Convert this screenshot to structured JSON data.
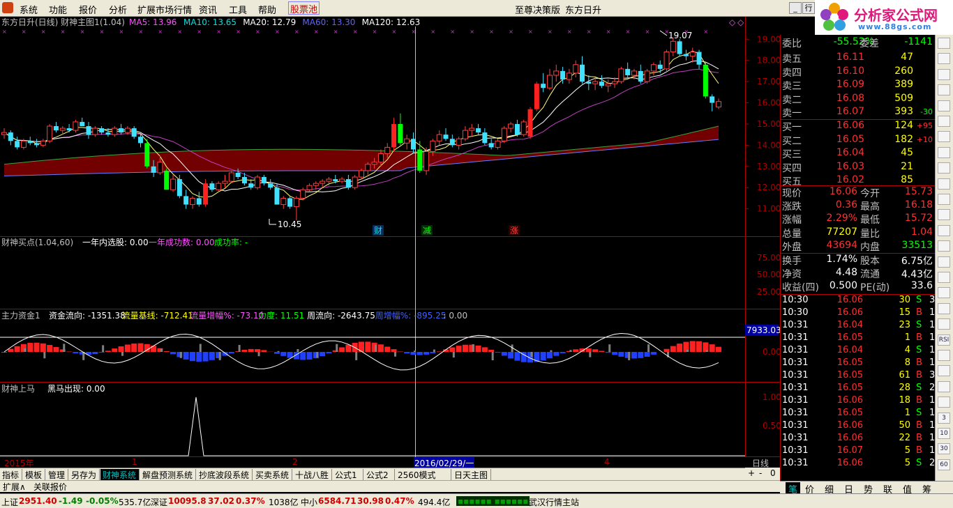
{
  "menu": {
    "items": [
      "系统",
      "功能",
      "报价",
      "分析",
      "扩展市场行情",
      "资讯",
      "工具",
      "帮助",
      "股票池"
    ],
    "center": "至尊决策版",
    "stock": "东方日升",
    "right_btn": "行"
  },
  "site_logo": {
    "title": "分析家公式网",
    "url": "www.88gs.com"
  },
  "main": {
    "title": "东方日升(日线) 财神主图1(1.04)",
    "ma": [
      {
        "label": "MA5: 13.96",
        "color": "#ff50ff"
      },
      {
        "label": "MA10: 13.65",
        "color": "#00e0e0"
      },
      {
        "label": "MA20: 12.79",
        "color": "#ffffff"
      },
      {
        "label": "MA60: 13.30",
        "color": "#6060ff"
      },
      {
        "label": "MA120: 12.63",
        "color": "#ffffff"
      }
    ],
    "high_label": "19.07",
    "low_label": "10.45",
    "signals": [
      {
        "text": "财",
        "color": "#00e0e0"
      },
      {
        "text": "减",
        "color": "#00ff00"
      },
      {
        "text": "涨",
        "color": "#ff4040"
      }
    ],
    "yticks": [
      "19.00",
      "18.00",
      "17.00",
      "16.00",
      "15.00",
      "14.00",
      "13.00",
      "12.00",
      "11.00"
    ]
  },
  "panel2": {
    "name": "财神买点(1.04,60)",
    "items": [
      {
        "text": "一年内选股: 0.00",
        "color": "#ffffff"
      },
      {
        "text": "一年成功数: 0.00",
        "color": "#ff50ff"
      },
      {
        "text": "成功率: -",
        "color": "#00ff00"
      }
    ],
    "yticks": [
      "75.00",
      "50.00",
      "25.00"
    ]
  },
  "panel3": {
    "name": "主力资金1",
    "items": [
      {
        "text": "资金流向: -1351.38",
        "color": "#ffffff"
      },
      {
        "text": "流量基线: -712.41",
        "color": "#ffff00"
      },
      {
        "text": "流量增幅%: -73.10",
        "color": "#ff50ff"
      },
      {
        "text": "力度: 11.51",
        "color": "#00ff00"
      },
      {
        "text": "周流向: -2643.75",
        "color": "#ffffff"
      },
      {
        "text": "周增幅%: -895.25",
        "color": "#4060ff"
      },
      {
        "text": ": 0.00",
        "color": "#c0c0c0"
      }
    ],
    "value_box": "7933.03",
    "ytick": "0.00"
  },
  "panel4": {
    "name": "财神上马",
    "items": [
      {
        "text": "黑马出现: 0.00",
        "color": "#ffffff"
      }
    ],
    "yticks": [
      "1.00",
      "0.50"
    ]
  },
  "xaxis": {
    "labels": [
      "2015年",
      "1",
      "2",
      "4"
    ],
    "cursor_date": "2016/02/29/一",
    "period": "日线"
  },
  "quote": {
    "webi": {
      "label": "委比",
      "value": "-55.52%",
      "label2": "委差",
      "value2": "-1141"
    },
    "sell": [
      {
        "label": "卖五",
        "price": "16.11",
        "vol": "47",
        "chg": ""
      },
      {
        "label": "卖四",
        "price": "16.10",
        "vol": "260",
        "chg": ""
      },
      {
        "label": "卖三",
        "price": "16.09",
        "vol": "389",
        "chg": ""
      },
      {
        "label": "卖二",
        "price": "16.08",
        "vol": "509",
        "chg": ""
      },
      {
        "label": "卖一",
        "price": "16.07",
        "vol": "393",
        "chg": "-30"
      }
    ],
    "buy": [
      {
        "label": "买一",
        "price": "16.06",
        "vol": "124",
        "chg": "+95"
      },
      {
        "label": "买二",
        "price": "16.05",
        "vol": "182",
        "chg": "+10"
      },
      {
        "label": "买三",
        "price": "16.04",
        "vol": "45",
        "chg": ""
      },
      {
        "label": "买四",
        "price": "16.03",
        "vol": "21",
        "chg": ""
      },
      {
        "label": "买五",
        "price": "16.02",
        "vol": "85",
        "chg": ""
      }
    ],
    "stats": [
      {
        "l1": "现价",
        "v1": "16.06",
        "c1": "#ff3030",
        "l2": "今开",
        "v2": "15.73",
        "c2": "#ff3030"
      },
      {
        "l1": "涨跌",
        "v1": "0.36",
        "c1": "#ff3030",
        "l2": "最高",
        "v2": "16.18",
        "c2": "#ff3030"
      },
      {
        "l1": "涨幅",
        "v1": "2.29%",
        "c1": "#ff3030",
        "l2": "最低",
        "v2": "15.72",
        "c2": "#ff3030"
      },
      {
        "l1": "总量",
        "v1": "77207",
        "c1": "#ffff00",
        "l2": "量比",
        "v2": "1.04",
        "c2": "#ff3030"
      },
      {
        "l1": "外盘",
        "v1": "43694",
        "c1": "#ff3030",
        "l2": "内盘",
        "v2": "33513",
        "c2": "#00ff00"
      }
    ],
    "stats2": [
      {
        "l1": "换手",
        "v1": "1.74%",
        "l2": "股本",
        "v2": "6.75亿"
      },
      {
        "l1": "净资",
        "v1": "4.48",
        "l2": "流通",
        "v2": "4.43亿"
      },
      {
        "l1": "收益(四)",
        "v1": "0.500",
        "l2": "PE(动)",
        "v2": "33.6"
      }
    ],
    "ticks": [
      {
        "t": "10:30",
        "p": "16.06",
        "v": "30",
        "d": "S",
        "n": "3"
      },
      {
        "t": "10:30",
        "p": "16.06",
        "v": "15",
        "d": "B",
        "n": "1"
      },
      {
        "t": "10:31",
        "p": "16.04",
        "v": "23",
        "d": "S",
        "n": "1"
      },
      {
        "t": "10:31",
        "p": "16.05",
        "v": "1",
        "d": "B",
        "n": "1"
      },
      {
        "t": "10:31",
        "p": "16.04",
        "v": "4",
        "d": "S",
        "n": "1"
      },
      {
        "t": "10:31",
        "p": "16.05",
        "v": "8",
        "d": "B",
        "n": "1"
      },
      {
        "t": "10:31",
        "p": "16.05",
        "v": "61",
        "d": "B",
        "n": "3"
      },
      {
        "t": "10:31",
        "p": "16.05",
        "v": "28",
        "d": "S",
        "n": "2"
      },
      {
        "t": "10:31",
        "p": "16.06",
        "v": "18",
        "d": "B",
        "n": "1"
      },
      {
        "t": "10:31",
        "p": "16.05",
        "v": "1",
        "d": "S",
        "n": "1"
      },
      {
        "t": "10:31",
        "p": "16.06",
        "v": "50",
        "d": "B",
        "n": "1"
      },
      {
        "t": "10:31",
        "p": "16.06",
        "v": "22",
        "d": "B",
        "n": "1"
      },
      {
        "t": "10:31",
        "p": "16.07",
        "v": "5",
        "d": "B",
        "n": "1"
      },
      {
        "t": "10:31",
        "p": "16.06",
        "v": "5",
        "d": "S",
        "n": "2"
      }
    ],
    "tabs": [
      "笔",
      "价",
      "细",
      "日",
      "势",
      "联",
      "值",
      "筹"
    ]
  },
  "rtoolbar": [
    "",
    "",
    "",
    "",
    "",
    "",
    "",
    "",
    "",
    "",
    "",
    "",
    "",
    "",
    "",
    "",
    "",
    "",
    "",
    "RSI",
    "",
    "",
    "",
    "",
    "3",
    "10",
    "30",
    "60"
  ],
  "tabs": [
    "指标",
    "模板",
    "管理",
    "另存为",
    "财神系统",
    "解盘预测系统",
    "抄底波段系统",
    "买卖系统",
    "十战八胜",
    "公式1",
    "公式2",
    "2560模式",
    "日天主图"
  ],
  "active_tab": "财神系统",
  "ctrl": [
    "+",
    "-",
    "0"
  ],
  "tabs2": [
    "扩展∧",
    "关联报价"
  ],
  "status": {
    "sh_label": "上证",
    "sh_val": "2951.40",
    "sh_chg": "-1.49",
    "sh_pct": "-0.05%",
    "sh_amt": "535.7亿",
    "sz_label": "深证",
    "sz_val": "10095.8",
    "sz_chg": "37.02",
    "sz_pct": "0.37%",
    "sz_amt": "1038亿",
    "zx_label": "中小",
    "zx_val": "6584.71",
    "zx_chg": "30.98",
    "zx_pct": "0.47%",
    "zx_amt": "494.4亿",
    "bars": "▪▪▪▪▪▪ ▪▪▪▪▪▪",
    "server": "武汉行情主站"
  },
  "chart_data": {
    "type": "candlestick",
    "ohlc": [
      [
        14.5,
        14.8,
        14.3,
        14.6
      ],
      [
        14.6,
        14.7,
        14.0,
        14.2
      ],
      [
        14.2,
        14.4,
        13.8,
        13.9
      ],
      [
        13.9,
        14.3,
        13.8,
        14.2
      ],
      [
        14.2,
        14.4,
        14.0,
        14.1
      ],
      [
        14.1,
        14.3,
        13.9,
        14.0
      ],
      [
        14.0,
        14.3,
        13.9,
        14.2
      ],
      [
        14.2,
        15.0,
        14.1,
        14.9
      ],
      [
        14.9,
        15.1,
        14.6,
        14.7
      ],
      [
        14.7,
        14.9,
        14.5,
        14.8
      ],
      [
        14.8,
        15.0,
        14.6,
        14.7
      ],
      [
        14.7,
        15.2,
        14.6,
        15.1
      ],
      [
        15.1,
        15.3,
        14.9,
        14.9
      ],
      [
        14.9,
        15.1,
        14.3,
        14.5
      ],
      [
        14.5,
        14.9,
        14.4,
        14.8
      ],
      [
        14.8,
        14.9,
        14.5,
        14.6
      ],
      [
        14.6,
        14.8,
        14.4,
        14.5
      ],
      [
        14.5,
        14.9,
        14.4,
        14.8
      ],
      [
        14.8,
        15.0,
        14.5,
        14.6
      ],
      [
        14.6,
        14.9,
        14.5,
        14.8
      ],
      [
        14.8,
        14.9,
        14.3,
        14.4
      ],
      [
        14.4,
        14.6,
        13.9,
        14.1
      ],
      [
        14.1,
        14.3,
        12.9,
        13.0
      ],
      [
        13.0,
        13.3,
        12.5,
        12.7
      ],
      [
        12.7,
        13.5,
        12.6,
        13.2
      ],
      [
        12.8,
        12.9,
        11.9,
        11.9
      ],
      [
        11.9,
        12.6,
        11.8,
        12.4
      ],
      [
        12.4,
        12.6,
        11.5,
        11.6
      ],
      [
        11.6,
        11.9,
        11.0,
        11.2
      ],
      [
        11.2,
        11.6,
        11.0,
        11.5
      ],
      [
        11.5,
        11.8,
        11.1,
        11.2
      ],
      [
        11.2,
        12.4,
        11.1,
        12.2
      ],
      [
        12.2,
        12.3,
        11.8,
        11.9
      ],
      [
        11.9,
        12.3,
        11.8,
        12.2
      ],
      [
        12.2,
        12.6,
        12.0,
        12.3
      ],
      [
        12.3,
        12.8,
        12.2,
        12.7
      ],
      [
        12.7,
        12.9,
        12.4,
        12.5
      ],
      [
        12.5,
        12.7,
        12.1,
        12.2
      ],
      [
        12.2,
        12.4,
        11.9,
        12.0
      ],
      [
        12.0,
        12.6,
        11.9,
        12.5
      ],
      [
        12.5,
        12.6,
        12.1,
        12.2
      ],
      [
        12.2,
        12.4,
        11.9,
        12.0
      ],
      [
        12.0,
        12.2,
        11.2,
        11.2
      ],
      [
        11.2,
        11.6,
        11.0,
        11.5
      ],
      [
        11.5,
        11.6,
        11.0,
        11.1
      ],
      [
        11.1,
        11.6,
        10.45,
        11.5
      ],
      [
        11.5,
        12.0,
        11.4,
        11.9
      ],
      [
        11.9,
        12.2,
        11.8,
        12.1
      ],
      [
        12.1,
        12.3,
        11.9,
        12.2
      ],
      [
        12.2,
        12.4,
        12.0,
        12.3
      ],
      [
        12.3,
        12.5,
        12.1,
        12.4
      ],
      [
        12.4,
        12.6,
        12.2,
        12.3
      ],
      [
        12.3,
        12.5,
        12.2,
        12.4
      ],
      [
        12.4,
        12.6,
        11.9,
        12.0
      ],
      [
        12.0,
        12.6,
        11.9,
        12.5
      ],
      [
        12.5,
        12.9,
        12.4,
        12.8
      ],
      [
        12.8,
        13.2,
        12.6,
        13.1
      ],
      [
        13.1,
        13.4,
        12.9,
        13.2
      ],
      [
        13.2,
        13.8,
        13.0,
        13.6
      ],
      [
        13.6,
        14.1,
        13.4,
        13.9
      ],
      [
        13.9,
        15.3,
        13.7,
        15.0
      ],
      [
        15.0,
        15.5,
        14.0,
        14.1
      ],
      [
        14.1,
        14.5,
        13.8,
        14.3
      ],
      [
        14.3,
        14.6,
        13.6,
        13.8
      ],
      [
        13.8,
        14.2,
        12.7,
        12.8
      ],
      [
        12.8,
        13.9,
        12.6,
        13.7
      ],
      [
        13.7,
        14.3,
        13.5,
        14.2
      ],
      [
        14.2,
        14.7,
        14.0,
        14.5
      ],
      [
        14.5,
        14.8,
        14.2,
        14.3
      ],
      [
        14.3,
        14.5,
        13.9,
        14.0
      ],
      [
        14.0,
        14.4,
        13.8,
        14.3
      ],
      [
        14.3,
        14.9,
        14.2,
        14.7
      ],
      [
        14.7,
        15.0,
        14.4,
        14.8
      ],
      [
        14.8,
        15.0,
        14.5,
        14.6
      ],
      [
        14.6,
        14.8,
        14.0,
        14.1
      ],
      [
        14.1,
        14.3,
        13.8,
        13.9
      ],
      [
        13.9,
        14.3,
        13.8,
        14.2
      ],
      [
        14.2,
        14.9,
        14.1,
        14.8
      ],
      [
        14.8,
        15.1,
        14.6,
        15.0
      ],
      [
        15.0,
        15.2,
        14.4,
        14.5
      ],
      [
        14.5,
        15.2,
        14.4,
        15.1
      ],
      [
        14.4,
        15.8,
        14.3,
        15.7
      ],
      [
        15.7,
        17.0,
        15.6,
        16.9
      ],
      [
        16.9,
        17.4,
        16.5,
        16.7
      ],
      [
        16.7,
        17.6,
        16.6,
        17.3
      ],
      [
        17.3,
        17.8,
        17.0,
        17.5
      ],
      [
        17.5,
        17.7,
        16.9,
        17.1
      ],
      [
        17.1,
        17.6,
        16.9,
        17.4
      ],
      [
        17.4,
        18.0,
        17.2,
        17.8
      ],
      [
        17.8,
        18.2,
        16.9,
        17.0
      ],
      [
        17.0,
        17.3,
        16.6,
        16.9
      ],
      [
        16.9,
        17.2,
        16.6,
        17.0
      ],
      [
        17.0,
        17.3,
        16.7,
        16.8
      ],
      [
        16.8,
        17.1,
        16.5,
        16.9
      ],
      [
        16.9,
        17.2,
        16.7,
        17.0
      ],
      [
        17.0,
        17.7,
        16.9,
        17.6
      ],
      [
        17.6,
        17.9,
        17.2,
        17.3
      ],
      [
        17.3,
        17.6,
        17.1,
        17.5
      ],
      [
        17.5,
        17.8,
        16.9,
        17.0
      ],
      [
        17.0,
        17.6,
        16.9,
        17.5
      ],
      [
        17.5,
        17.9,
        17.3,
        17.8
      ],
      [
        17.8,
        18.0,
        17.4,
        17.6
      ],
      [
        17.6,
        18.5,
        17.5,
        18.4
      ],
      [
        18.4,
        19.07,
        18.2,
        18.9
      ],
      [
        18.9,
        19.0,
        18.2,
        18.3
      ],
      [
        18.3,
        18.5,
        18.0,
        18.2
      ],
      [
        18.2,
        18.6,
        17.9,
        18.4
      ],
      [
        18.4,
        18.5,
        17.6,
        17.8
      ],
      [
        17.8,
        17.9,
        16.2,
        16.3
      ],
      [
        16.3,
        16.4,
        15.6,
        16.0
      ],
      [
        15.8,
        16.2,
        15.7,
        16.06
      ]
    ],
    "ma_series": [
      "MA5",
      "MA10",
      "MA20",
      "MA60",
      "MA120"
    ],
    "y_range": [
      10.2,
      19.6
    ],
    "cursor_index": 64
  }
}
